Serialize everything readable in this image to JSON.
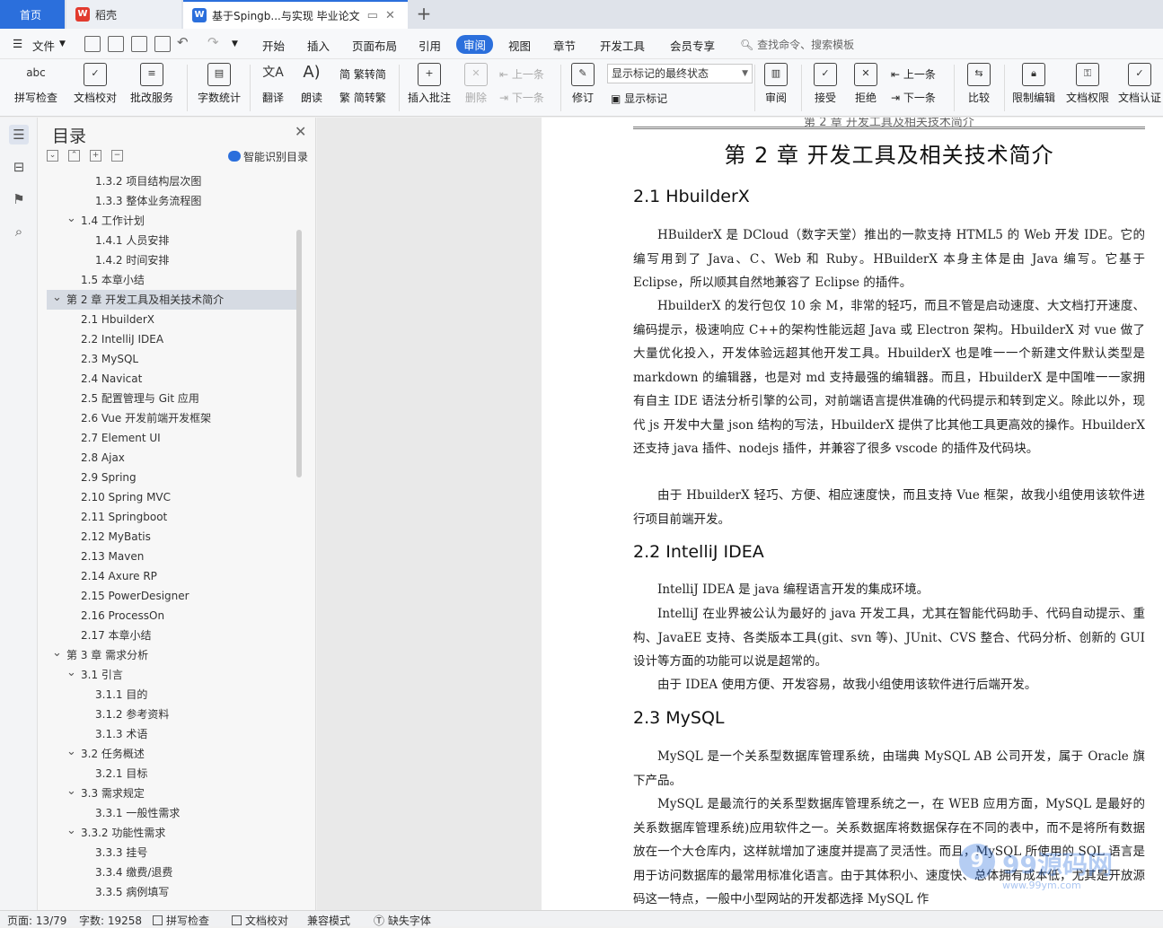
{
  "tabs": {
    "home": "首页",
    "daoke": "稻壳",
    "doc": "基于Spingb...与实现 毕业论文",
    "new_tab": "+"
  },
  "menu": {
    "file": "文件",
    "items": [
      "开始",
      "插入",
      "页面布局",
      "引用",
      "审阅",
      "视图",
      "章节",
      "开发工具",
      "会员专享"
    ],
    "active": "审阅",
    "search": "查找命令、搜索模板"
  },
  "ribbon": {
    "spell": "拼写检查",
    "doc_check": "文档校对",
    "batch": "批改服务",
    "word_count": "字数统计",
    "translate": "翻译",
    "read": "朗读",
    "trad": "繁转简",
    "simp": "简转繁",
    "insert_comment": "插入批注",
    "delete": "删除",
    "prev": "上一条",
    "next": "下一条",
    "track": "修订",
    "markup_select": "显示标记的最终状态",
    "show_markup": "显示标记",
    "review_pane": "审阅",
    "accept": "接受",
    "reject": "拒绝",
    "prev2": "上一条",
    "next2": "下一条",
    "compare": "比较",
    "restrict": "限制编辑",
    "doc_rights": "文档权限",
    "doc_auth": "文档认证"
  },
  "toc": {
    "title": "目录",
    "smart": "智能识别目录",
    "items": [
      {
        "text": "1.3.2  项目结构层次图",
        "level": 3
      },
      {
        "text": "1.3.3  整体业务流程图",
        "level": 3
      },
      {
        "text": "1.4  工作计划",
        "level": 2,
        "caret": true
      },
      {
        "text": "1.4.1  人员安排",
        "level": 3
      },
      {
        "text": "1.4.2  时间安排",
        "level": 3
      },
      {
        "text": "1.5  本章小结",
        "level": 2
      },
      {
        "text": "第 2 章    开发工具及相关技术简介",
        "level": 1,
        "caret": true,
        "active": true
      },
      {
        "text": "2.1 HbuilderX",
        "level": 2
      },
      {
        "text": "2.2 IntelliJ IDEA",
        "level": 2
      },
      {
        "text": "2.3 MySQL",
        "level": 2
      },
      {
        "text": "2.4 Navicat",
        "level": 2
      },
      {
        "text": "2.5  配置管理与 Git 应用",
        "level": 2
      },
      {
        "text": "2.6 Vue 开发前端开发框架",
        "level": 2
      },
      {
        "text": "2.7 Element UI",
        "level": 2
      },
      {
        "text": "2.8 Ajax",
        "level": 2
      },
      {
        "text": "2.9 Spring",
        "level": 2
      },
      {
        "text": "2.10 Spring MVC",
        "level": 2
      },
      {
        "text": "2.11 Springboot",
        "level": 2
      },
      {
        "text": "2.12 MyBatis",
        "level": 2
      },
      {
        "text": "2.13 Maven",
        "level": 2
      },
      {
        "text": "2.14 Axure RP",
        "level": 2
      },
      {
        "text": "2.15 PowerDesigner",
        "level": 2
      },
      {
        "text": "2.16 ProcessOn",
        "level": 2
      },
      {
        "text": "2.17  本章小结",
        "level": 2
      },
      {
        "text": "第 3 章  需求分析",
        "level": 1,
        "caret": true
      },
      {
        "text": "3.1 引言",
        "level": 2,
        "caret": true
      },
      {
        "text": "3.1.1 目的",
        "level": 3
      },
      {
        "text": "3.1.2 参考资料",
        "level": 3
      },
      {
        "text": "3.1.3 术语",
        "level": 3
      },
      {
        "text": "3.2 任务概述",
        "level": 2,
        "caret": true
      },
      {
        "text": "3.2.1 目标",
        "level": 3
      },
      {
        "text": "3.3 需求规定",
        "level": 2,
        "caret": true
      },
      {
        "text": "3.3.1 一般性需求",
        "level": 3
      },
      {
        "text": "3.3.2 功能性需求",
        "level": 2,
        "caret": true
      },
      {
        "text": "3.3.3 挂号",
        "level": 3
      },
      {
        "text": "3.3.4 缴费/退费",
        "level": 3
      },
      {
        "text": "3.3.5 病例填写",
        "level": 3
      }
    ]
  },
  "doc": {
    "running_head": "第 2 章 开发工具及相关技术简介",
    "chapter_title": "第 2 章    开发工具及相关技术简介",
    "h_2_1": "2.1 HbuilderX",
    "p1": "HBuilderX 是 DCloud（数字天堂）推出的一款支持 HTML5 的 Web 开发 IDE。它的编写用到了 Java、C、Web 和 Ruby。HBuilderX 本身主体是由 Java 编写。它基于 Eclipse，所以顺其自然地兼容了 Eclipse 的插件。",
    "p2": "HbuilderX 的发行包仅 10 余 M，非常的轻巧，而且不管是启动速度、大文档打开速度、编码提示，极速响应 C++的架构性能远超 Java 或 Electron 架构。HbuilderX 对 vue 做了大量优化投入，开发体验远超其他开发工具。HbuilderX 也是唯一一个新建文件默认类型是 markdown 的编辑器，也是对 md 支持最强的编辑器。而且，HbuilderX 是中国唯一一家拥有自主 IDE 语法分析引擎的公司，对前端语言提供准确的代码提示和转到定义。除此以外，现代 js 开发中大量 json 结构的写法，HbuilderX 提供了比其他工具更高效的操作。HbuilderX 还支持 java 插件、nodejs 插件，并兼容了很多 vscode 的插件及代码块。",
    "p3": "由于 HbuilderX 轻巧、方便、相应速度快，而且支持 Vue 框架，故我小组使用该软件进行项目前端开发。",
    "h_2_2": "2.2 IntelliJ IDEA",
    "p4": "IntelliJ IDEA 是 java 编程语言开发的集成环境。",
    "p5": "IntelliJ 在业界被公认为最好的 java 开发工具，尤其在智能代码助手、代码自动提示、重构、JavaEE 支持、各类版本工具(git、svn 等)、JUnit、CVS 整合、代码分析、创新的 GUI 设计等方面的功能可以说是超常的。",
    "p6": "由于 IDEA 使用方便、开发容易，故我小组使用该软件进行后端开发。",
    "h_2_3": "2.3 MySQL",
    "p7": "MySQL 是一个关系型数据库管理系统，由瑞典 MySQL AB 公司开发，属于 Oracle 旗下产品。",
    "p8": "MySQL 是最流行的关系型数据库管理系统之一，在 WEB 应用方面，MySQL 是最好的关系数据库管理系统)应用软件之一。关系数据库将数据保存在不同的表中，而不是将所有数据放在一个大仓库内，这样就增加了速度并提高了灵活性。而且，MySQL 所使用的 SQL 语言是用于访问数据库的最常用标准化语言。由于其体积小、速度快、总体拥有成本低，尤其是开放源码这一特点，一般中小型网站的开发都选择 MySQL 作"
  },
  "watermark": {
    "logo": "9",
    "text": "99源码网",
    "sub": "www.99ym.com"
  },
  "status": {
    "page": "页面: 13/79",
    "words": "字数: 19258",
    "spell": "拼写检查",
    "proof": "文档校对",
    "compat": "兼容模式",
    "missing_font": "缺失字体"
  },
  "colors": {
    "accent": "#2b6fdc",
    "spell_underline": "#d9342b",
    "toc_active": "#d6dbe3"
  }
}
